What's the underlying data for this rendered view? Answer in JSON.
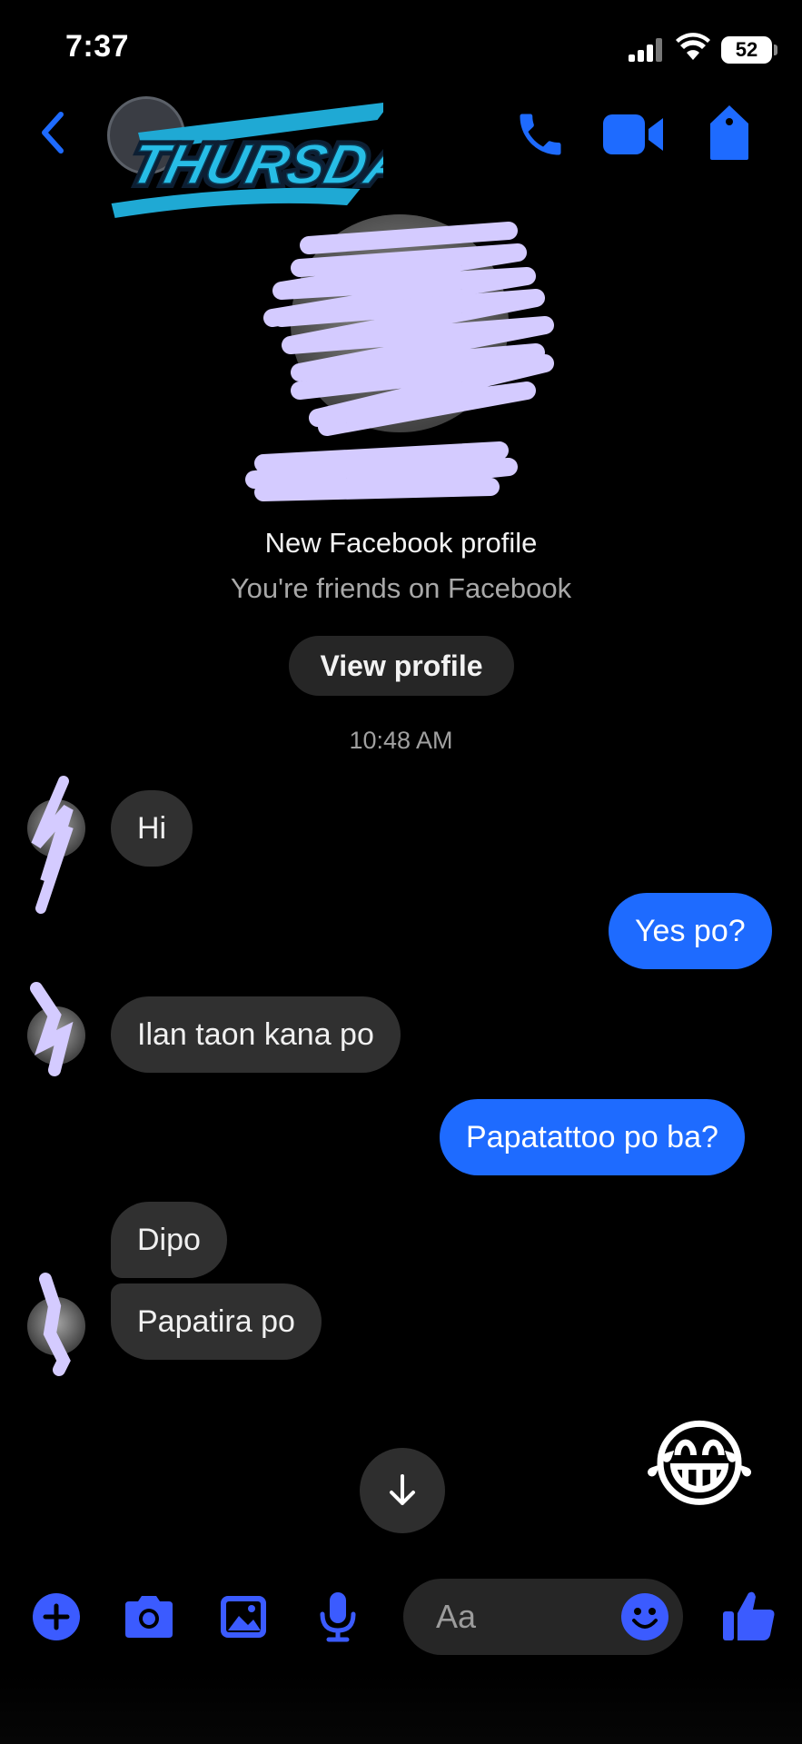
{
  "status_bar": {
    "time": "7:37",
    "battery": "52"
  },
  "header": {
    "contact_logo_text": "THURSDAY"
  },
  "profile": {
    "title": "New Facebook profile",
    "subtitle": "You're friends on Facebook",
    "view_profile_label": "View profile"
  },
  "conversation": {
    "timestamp": "10:48 AM",
    "messages": [
      {
        "from": "them",
        "text": "Hi"
      },
      {
        "from": "me",
        "text": "Yes po?"
      },
      {
        "from": "them",
        "text": "Ilan taon kana po"
      },
      {
        "from": "me",
        "text": "Papatattoo po ba?"
      },
      {
        "from": "them",
        "text": "Dipo"
      },
      {
        "from": "them",
        "text": "Papatira po"
      }
    ],
    "reaction_emoji": "😂"
  },
  "composer": {
    "placeholder": "Aa"
  },
  "colors": {
    "accent": "#1e6bff",
    "incoming_bubble": "#303030",
    "icon": "#3b5bff",
    "scribble": "#d4cbff"
  },
  "icons": [
    "back-icon",
    "phone-icon",
    "video-camera-icon",
    "tag-icon",
    "plus-icon",
    "camera-icon",
    "image-icon",
    "microphone-icon",
    "smiley-icon",
    "thumbs-up-icon",
    "arrow-down-icon"
  ]
}
